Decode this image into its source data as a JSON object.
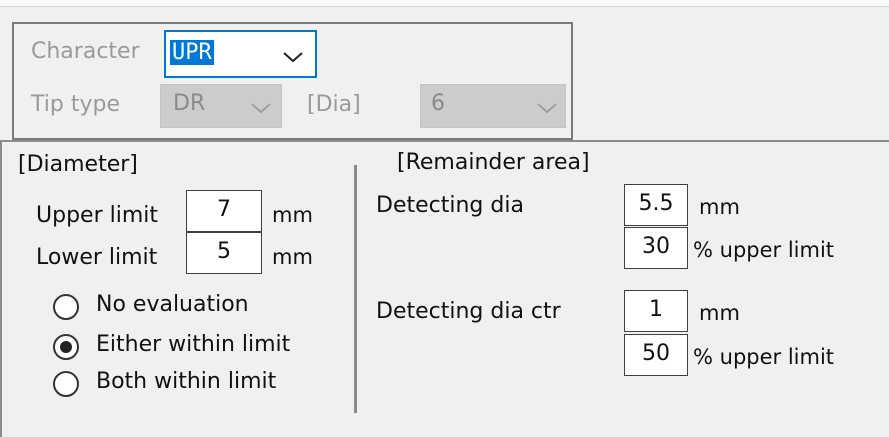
{
  "character_group": {
    "character_label": "Character",
    "character_value": "UPR",
    "tip_type_label": "Tip type",
    "tip_type_value": "DR",
    "dia_label": "[Dia]",
    "dia_value": "6",
    "chevron_icon": "chevron-down-icon"
  },
  "diameter": {
    "header": "[Diameter]",
    "upper_label": "Upper limit",
    "upper_value": "7",
    "upper_unit": "mm",
    "lower_label": "Lower limit",
    "lower_value": "5",
    "lower_unit": "mm",
    "radio_options": [
      {
        "label": "No evaluation",
        "selected": false
      },
      {
        "label": "Either within limit",
        "selected": true
      },
      {
        "label": "Both within limit",
        "selected": false
      }
    ]
  },
  "remainder": {
    "header": "[Remainder area]",
    "detect_dia_label": "Detecting dia",
    "detect_dia_value": "5.5",
    "detect_dia_unit": "mm",
    "detect_dia_pct_value": "30",
    "detect_dia_pct_unit": "% upper limit",
    "detect_ctr_label": "Detecting dia ctr",
    "detect_ctr_value": "1",
    "detect_ctr_unit": "mm",
    "detect_ctr_pct_value": "50",
    "detect_ctr_pct_unit": "% upper limit"
  },
  "colors": {
    "selection": "#0078d7",
    "disabled_text": "#9a9a9a",
    "disabled_fill": "#cccccc"
  }
}
